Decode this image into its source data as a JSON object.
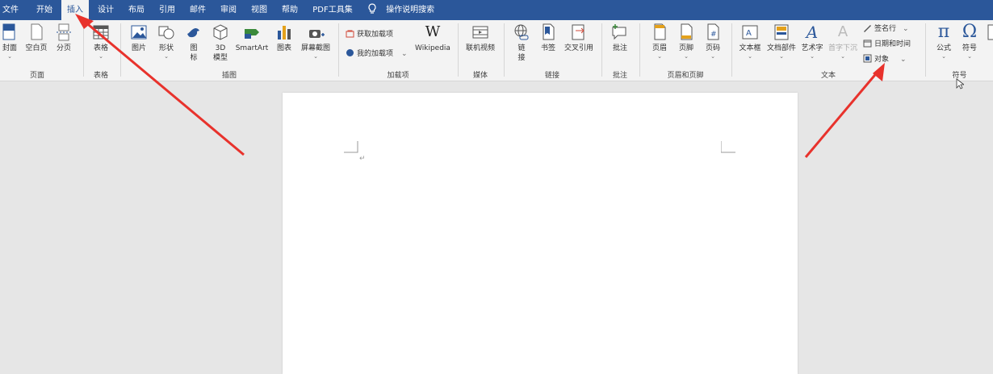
{
  "menu": {
    "tabs": [
      {
        "label": "文件"
      },
      {
        "label": "开始"
      },
      {
        "label": "插入"
      },
      {
        "label": "设计"
      },
      {
        "label": "布局"
      },
      {
        "label": "引用"
      },
      {
        "label": "邮件"
      },
      {
        "label": "审阅"
      },
      {
        "label": "视图"
      },
      {
        "label": "帮助"
      },
      {
        "label": "PDF工具集"
      }
    ],
    "active_tab": "插入",
    "tell_me": "操作说明搜索"
  },
  "ribbon": {
    "pages": {
      "group_label": "页面",
      "cover": "封面",
      "blank_page": "空白页",
      "page_break": "分页"
    },
    "tables": {
      "group_label": "表格",
      "table": "表格"
    },
    "illustrations": {
      "group_label": "插图",
      "pictures": "图片",
      "shapes": "形状",
      "icons_line1": "图",
      "icons_line2": "标",
      "model3d_line1": "3D",
      "model3d_line2": "模型",
      "smartart": "SmartArt",
      "chart": "图表",
      "screenshot": "屏幕截图"
    },
    "addins": {
      "group_label": "加载项",
      "get_addins": "获取加载项",
      "my_addins": "我的加载项",
      "wikipedia": "Wikipedia"
    },
    "media": {
      "group_label": "媒体",
      "online_video": "联机视频"
    },
    "links": {
      "group_label": "链接",
      "link_line1": "链",
      "link_line2": "接",
      "bookmark": "书签",
      "cross_ref": "交叉引用"
    },
    "comments": {
      "group_label": "批注",
      "comment": "批注"
    },
    "header_footer": {
      "group_label": "页眉和页脚",
      "header": "页眉",
      "footer": "页脚",
      "page_number": "页码"
    },
    "text": {
      "group_label": "文本",
      "text_box": "文本框",
      "quick_parts": "文档部件",
      "wordart": "艺术字",
      "drop_cap": "首字下沉",
      "signature_line": "签名行",
      "date_time": "日期和时间",
      "object": "对象"
    },
    "symbols": {
      "group_label": "符号",
      "equation": "公式",
      "symbol": "符号"
    }
  },
  "document": {
    "paragraph_mark": "↵"
  },
  "colors": {
    "title_bar": "#2b579a",
    "ribbon_bg": "#f3f3f3",
    "arrow_red": "#e8322c",
    "canvas": "#e6e6e6"
  }
}
